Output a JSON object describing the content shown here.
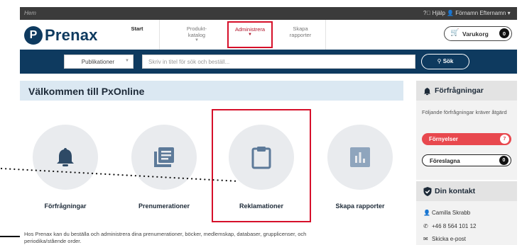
{
  "topbar": {
    "home": "Hem",
    "help": "Hjälp",
    "user": "Förnamn Efternamn"
  },
  "logo": {
    "mark": "P",
    "text": "Prenax"
  },
  "nav": {
    "start": "Start",
    "produkt_l1": "Produkt-",
    "produkt_l2": "katalog",
    "admin": "Administrera",
    "skapa_l1": "Skapa",
    "skapa_l2": "rapporter"
  },
  "cart": {
    "label": "Varukorg",
    "count": "0"
  },
  "search": {
    "select_value": "Publikationer",
    "placeholder": "Skriv in titel för sök och beställ...",
    "button": "Sök"
  },
  "welcome": "Välkommen till PxOnline",
  "tiles": [
    {
      "label": "Förfrågningar",
      "icon": "bell-icon"
    },
    {
      "label": "Prenumerationer",
      "icon": "list-icon"
    },
    {
      "label": "Reklamationer",
      "icon": "clipboard-icon"
    },
    {
      "label": "Skapa rapporter",
      "icon": "bar-chart-icon"
    }
  ],
  "bottom_text_1": "Hos Prenax kan du beställa och administrera dina prenumerationer, böcker, medlemskap, databaser, grupplicenser, och",
  "bottom_text_2": "periodika/stående order.",
  "requests": {
    "title": "Förfrågningar",
    "note": "Följande förfrågningar kräver åtgärd",
    "items": [
      {
        "label": "Förnyelser",
        "count": "7"
      },
      {
        "label": "Föreslagna",
        "count": "0"
      }
    ]
  },
  "contact": {
    "title": "Din kontakt",
    "name": "Camilla Skrabb",
    "phone": "+46 8 564 101 12",
    "email": "Skicka e-post"
  },
  "colors": {
    "brand": "#0e3a5f",
    "accent_red": "#d6102a",
    "pill_red": "#e8484e"
  }
}
